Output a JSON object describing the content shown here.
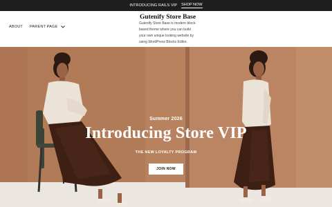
{
  "announcement": {
    "text": "INTRODUCING RAILS VIP",
    "link_label": "SHOP NOW"
  },
  "header": {
    "nav": [
      {
        "label": "ABOUT"
      },
      {
        "label": "PARENT PAGE",
        "has_dropdown": true
      }
    ],
    "site_title": "Gutenify Store Base",
    "site_description": "Gutenify Store Base is modern block-based theme where you can build your own unique looking website by using WordPress Blocks Editor."
  },
  "hero": {
    "eyebrow": "Summer 2026",
    "title": "Introducing Store VIP",
    "subheading": "THE NEW LOYALTY PROGRAM",
    "button_label": "JOIN NOW"
  },
  "colors": {
    "topbar_bg": "#1e1e1e",
    "hero_bg": "#b07a58",
    "button_bg": "#ffffff",
    "text_on_image": "#ffffff"
  }
}
